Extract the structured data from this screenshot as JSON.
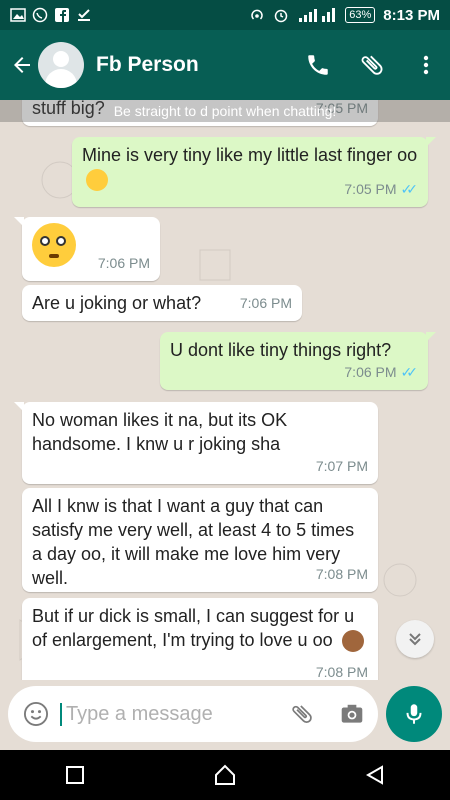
{
  "status": {
    "time": "8:13 PM",
    "battery": "63%",
    "network": "H+"
  },
  "header": {
    "contact_name": "Fb Person"
  },
  "chat": {
    "banner": "Be straight to d point when chatting!",
    "partial_top_text": "stuff big?",
    "partial_top_time": "7:05 PM",
    "messages": [
      {
        "dir": "out",
        "text": "Mine is very tiny like my little last finger oo",
        "time": "7:05 PM"
      },
      {
        "dir": "in",
        "text": "",
        "time": "7:06 PM"
      },
      {
        "dir": "in",
        "text": "Are u joking or what?",
        "time": "7:06 PM"
      },
      {
        "dir": "out",
        "text": "U dont like tiny things right?",
        "time": "7:06 PM"
      },
      {
        "dir": "in",
        "text": "No woman likes it na, but its OK handsome. I knw u r joking sha",
        "time": "7:07 PM"
      },
      {
        "dir": "in",
        "text": "All I knw is that I want a guy that can satisfy me very well, at least 4 to 5 times a day oo, it will make me love him very well.",
        "time": "7:08 PM"
      },
      {
        "dir": "in",
        "text": "But if ur dick is small, I can suggest for u of enlargement, I'm trying to love u oo",
        "time": "7:08 PM"
      }
    ]
  },
  "input": {
    "placeholder": "Type a message"
  },
  "icons": {
    "back": "arrow-left-icon",
    "call": "phone-icon",
    "attach": "paperclip-icon",
    "menu": "more-vert-icon",
    "emoji": "smiley-icon",
    "camera": "camera-icon",
    "mic": "microphone-icon",
    "scroll": "double-chevron-down-icon"
  },
  "colors": {
    "header": "#075e54",
    "statusbar": "#054d44",
    "incoming": "#ffffff",
    "outgoing": "#dcf8c6",
    "accent": "#00897b",
    "read_ticks": "#4fc3f7"
  }
}
